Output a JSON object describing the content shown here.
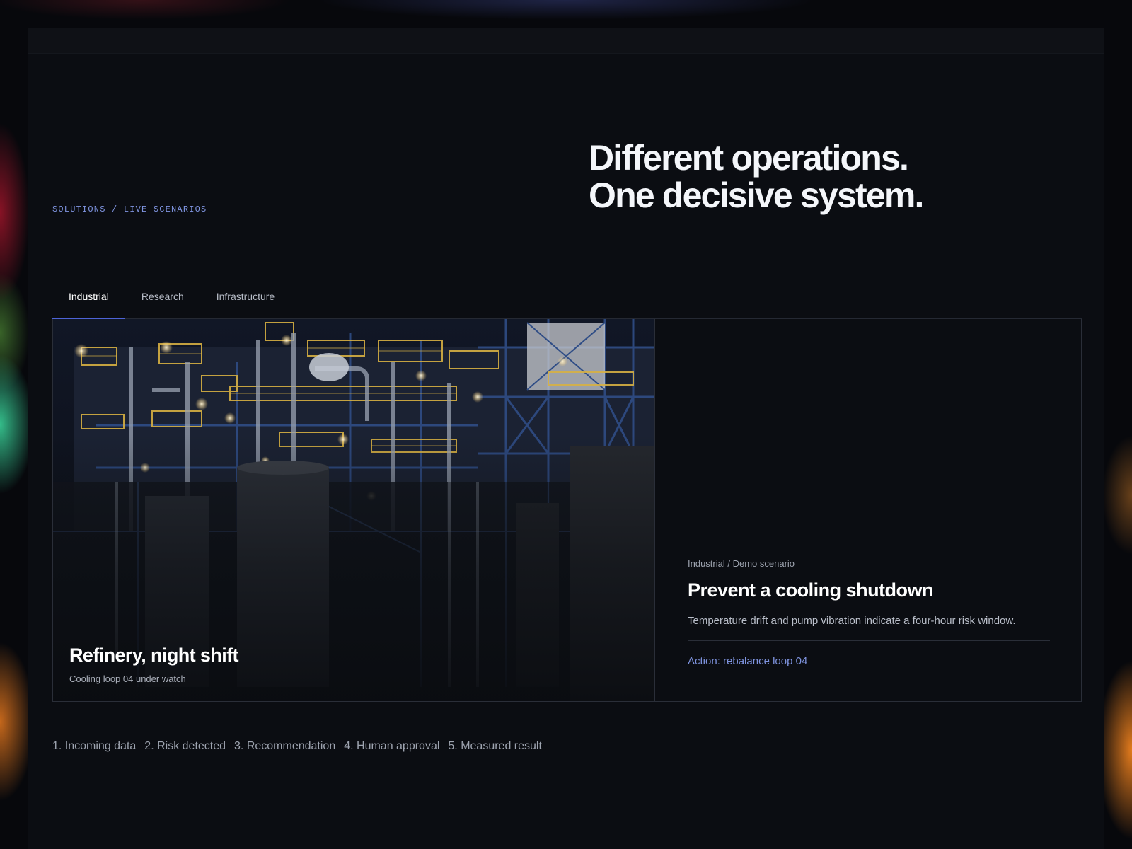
{
  "eyebrow": "SOLUTIONS / LIVE SCENARIOS",
  "headline": {
    "line1": "Different operations.",
    "line2": "One decisive system."
  },
  "tabs": [
    {
      "label": "Industrial",
      "active": true
    },
    {
      "label": "Research",
      "active": false
    },
    {
      "label": "Infrastructure",
      "active": false
    }
  ],
  "media": {
    "title": "Refinery, night shift",
    "subtitle": "Cooling loop 04 under watch"
  },
  "detail": {
    "kicker": "Industrial / Demo scenario",
    "title": "Prevent a cooling shutdown",
    "description": "Temperature drift and pump vibration indicate a four-hour risk window.",
    "action": "Action: rebalance loop 04"
  },
  "steps": [
    "1. Incoming data",
    "2. Risk detected",
    "3. Recommendation",
    "4. Human approval",
    "5. Measured result"
  ],
  "colors": {
    "accent": "#4d63d6",
    "link": "#7f94e0",
    "background": "#0b0d12"
  }
}
